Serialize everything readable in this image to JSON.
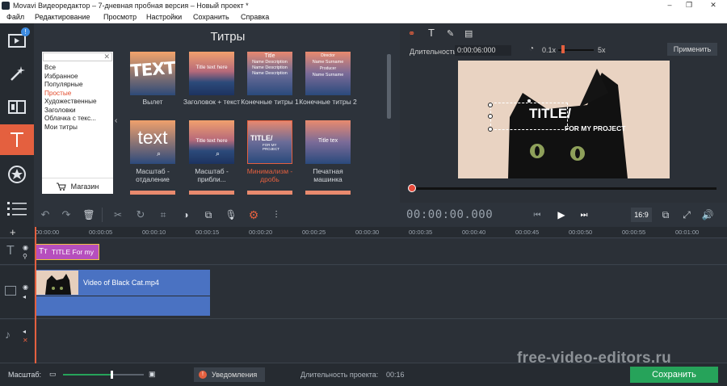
{
  "window": {
    "title": "Movavi Видеоредактор – 7-дневная пробная версия – Новый проект *"
  },
  "menu": [
    "Файл",
    "Редактирование",
    "Просмотр",
    "Настройки",
    "Сохранить",
    "Справка"
  ],
  "sidebar": {
    "badge": "!"
  },
  "panel": {
    "title": "Титры",
    "search_placeholder": "",
    "categories": [
      "Все",
      "Избранное",
      "Популярные",
      "Простые",
      "Художественные",
      "Заголовки",
      "Облачка с текс...",
      "Мои титры"
    ],
    "selected_category": "Простые",
    "shop_label": "Магазин",
    "tiles": [
      {
        "caption": "Вылет",
        "text": "TEXT"
      },
      {
        "caption": "Заголовок + текст",
        "text": "Title text here"
      },
      {
        "caption": "Конечные титры 1",
        "text": "Title"
      },
      {
        "caption": "Конечные титры 2",
        "text": "Director"
      },
      {
        "caption": "Масштаб - отдаление",
        "text": "text"
      },
      {
        "caption": "Масштаб - прибли...",
        "text": "Title text here"
      },
      {
        "caption": "Минимализм - дробь",
        "text": "TITLE/"
      },
      {
        "caption": "Печатная машинка",
        "text": "Title tex"
      }
    ],
    "tile3_lines": [
      "Name Description",
      "Name Description",
      "Name Description"
    ],
    "tile4_lines": [
      "Name Surname",
      "Producer",
      "Name Surname"
    ],
    "tile7_sub": "FOR MY PROJECT"
  },
  "preview": {
    "duration_label": "Длительность:",
    "duration_value": "0:00:06:000",
    "speed_min": "0.1x",
    "speed_max": "5x",
    "apply_label": "Применить",
    "overlay_title": "TITLE/",
    "overlay_sub": "FOR MY PROJECT",
    "timecode": "00:00:00.000",
    "aspect": "16:9"
  },
  "timeline": {
    "ticks": [
      "00:00:00",
      "00:00:05",
      "00:00:10",
      "00:00:15",
      "00:00:20",
      "00:00:25",
      "00:00:30",
      "00:00:35",
      "00:00:40",
      "00:00:45",
      "00:00:50",
      "00:00:55",
      "00:01:00"
    ],
    "title_clip": "TITLE For my",
    "video_clip": "Video of Black Cat.mp4"
  },
  "status": {
    "scale_label": "Масштаб:",
    "scale_fraction": 0.6,
    "notifications": "Уведомления",
    "project_duration_label": "Длительность проекта:",
    "project_duration": "00:16",
    "save_label": "Сохранить"
  },
  "watermark": "free-video-editors.ru",
  "colors": {
    "accent": "#e4603f",
    "save": "#26a35a",
    "clip": "#4a72c2",
    "title_clip": "#b64fbd"
  }
}
